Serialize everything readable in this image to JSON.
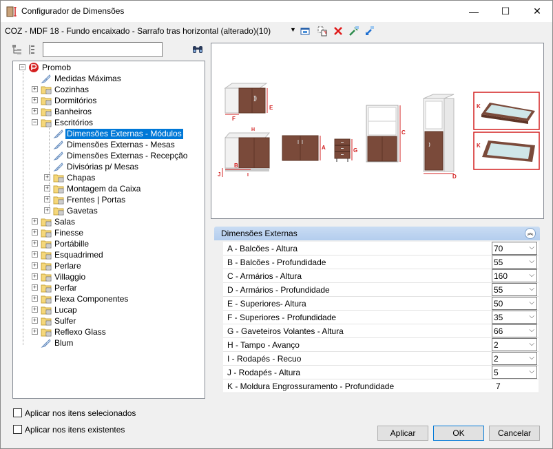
{
  "window": {
    "title": "Configurador de Dimensões",
    "minimize": "—",
    "maximize": "☐",
    "close": "✕"
  },
  "config": {
    "name": "COZ - MDF 18 - Fundo encaixado - Sarrafo tras horizontal (alterado)(10)"
  },
  "search": {
    "value": "",
    "placeholder": ""
  },
  "tree": {
    "root": "Promob",
    "items": [
      "Medidas Máximas",
      "Cozinhas",
      "Dormitórios",
      "Banheiros",
      "Escritórios",
      "Dimensões Externas - Módulos",
      "Dimensões Externas - Mesas",
      "Dimensões Externas - Recepção",
      "Divisórias p/ Mesas",
      "Chapas",
      "Montagem da Caixa",
      "Frentes | Portas",
      "Gavetas",
      "Salas",
      "Finesse",
      "Portábille",
      "Esquadrimed",
      "Perlare",
      "Villaggio",
      "Perfar",
      "Flexa Componentes",
      "Lucap",
      "Sulfer",
      "Reflexo Glass",
      "Blum"
    ]
  },
  "preview": {
    "letters": [
      "E",
      "F",
      "H",
      "B",
      "J",
      "I",
      "A",
      "G",
      "C",
      "D",
      "K",
      "K"
    ],
    "colors": {
      "wood": "#7a4a3a",
      "wood_dark": "#5e3426",
      "white": "#f2f2f2",
      "red": "#d32020",
      "glass": "#cfe6e8"
    }
  },
  "props": {
    "section_title": "Dimensões Externas",
    "rows": [
      {
        "name": "A - Balcões - Altura",
        "value": "70"
      },
      {
        "name": "B - Balcões - Profundidade",
        "value": "55"
      },
      {
        "name": "C - Armários - Altura",
        "value": "160"
      },
      {
        "name": "D - Armários - Profundidade",
        "value": "55"
      },
      {
        "name": "E - Superiores- Altura",
        "value": "50"
      },
      {
        "name": "F - Superiores - Profundidade",
        "value": "35"
      },
      {
        "name": "G - Gaveteiros Volantes - Altura",
        "value": "66"
      },
      {
        "name": "H - Tampo - Avanço",
        "value": "2"
      },
      {
        "name": "I - Rodapés - Recuo",
        "value": "2"
      },
      {
        "name": "J - Rodapés - Altura",
        "value": "5"
      },
      {
        "name": "K - Moldura Engrossuramento - Profundidade",
        "value": "7"
      }
    ]
  },
  "options": {
    "apply_selected": "Aplicar nos itens selecionados",
    "apply_existing": "Aplicar nos itens existentes"
  },
  "buttons": {
    "apply": "Aplicar",
    "ok": "OK",
    "cancel": "Cancelar"
  }
}
